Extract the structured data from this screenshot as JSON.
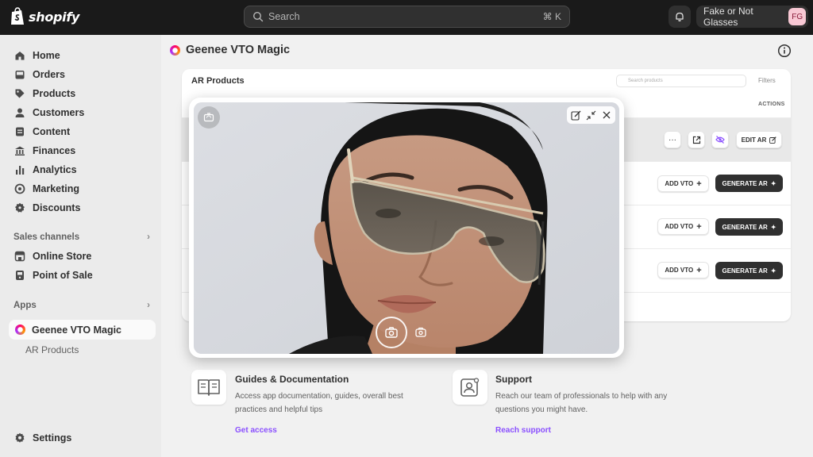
{
  "topbar": {
    "brand": "shopify",
    "search_placeholder": "Search",
    "search_shortcut": "⌘ K",
    "store_name": "Fake or Not Glasses",
    "store_initials": "FG"
  },
  "sidebar": {
    "items": [
      {
        "label": "Home",
        "icon": "home-icon"
      },
      {
        "label": "Orders",
        "icon": "inbox-icon"
      },
      {
        "label": "Products",
        "icon": "tag-icon"
      },
      {
        "label": "Customers",
        "icon": "person-icon"
      },
      {
        "label": "Content",
        "icon": "document-icon"
      },
      {
        "label": "Finances",
        "icon": "bank-icon"
      },
      {
        "label": "Analytics",
        "icon": "bar-chart-icon"
      },
      {
        "label": "Marketing",
        "icon": "target-icon"
      },
      {
        "label": "Discounts",
        "icon": "discount-icon"
      }
    ],
    "sales_channels_label": "Sales channels",
    "channels": [
      {
        "label": "Online Store",
        "icon": "store-icon"
      },
      {
        "label": "Point of Sale",
        "icon": "pos-icon"
      }
    ],
    "apps_label": "Apps",
    "active_app": "Geenee VTO Magic",
    "sub_item": "AR Products",
    "settings": "Settings"
  },
  "main": {
    "title": "Geenee VTO Magic",
    "card_title": "AR Products",
    "search_placeholder": "Search products",
    "filter_label": "Filters",
    "actions_header": "ACTIONS",
    "edit_ar_label": "EDIT AR",
    "add_vto_label": "ADD VTO",
    "generate_ar_label": "GENERATE AR",
    "guides": {
      "title": "Guides & Documentation",
      "description": "Access app documentation, guides, overall best practices and helpful tips",
      "link": "Get access"
    },
    "support": {
      "title": "Support",
      "description": "Reach our team of professionals to help with any questions you might have.",
      "link": "Reach support"
    }
  },
  "colors": {
    "topbar": "#1a1a1a",
    "sidebar": "#ebebeb",
    "primary_button": "#303030",
    "link": "#8a4fff"
  }
}
